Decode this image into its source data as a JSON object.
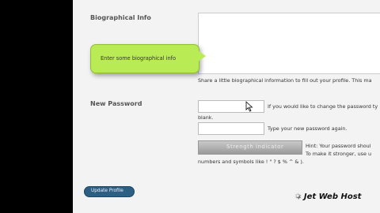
{
  "bio": {
    "label": "Biographical Info",
    "hint": "Share a little biographical information to fill out your profile. This ma",
    "callout": "Enter some biographical info"
  },
  "password": {
    "label": "New Password",
    "hint1": "If you would like to change the password ty",
    "hint1b": "blank.",
    "hint2": "Type your new password again.",
    "strength": "Strength indicator",
    "hint3": "Hint: Your password shoul",
    "hint4": "To make it stronger, use u",
    "hint5": "numbers and symbols like ! \" ? $ % ^ & )."
  },
  "button": {
    "label": "Update Profile"
  },
  "logo": {
    "text": "Jet Web Host"
  }
}
